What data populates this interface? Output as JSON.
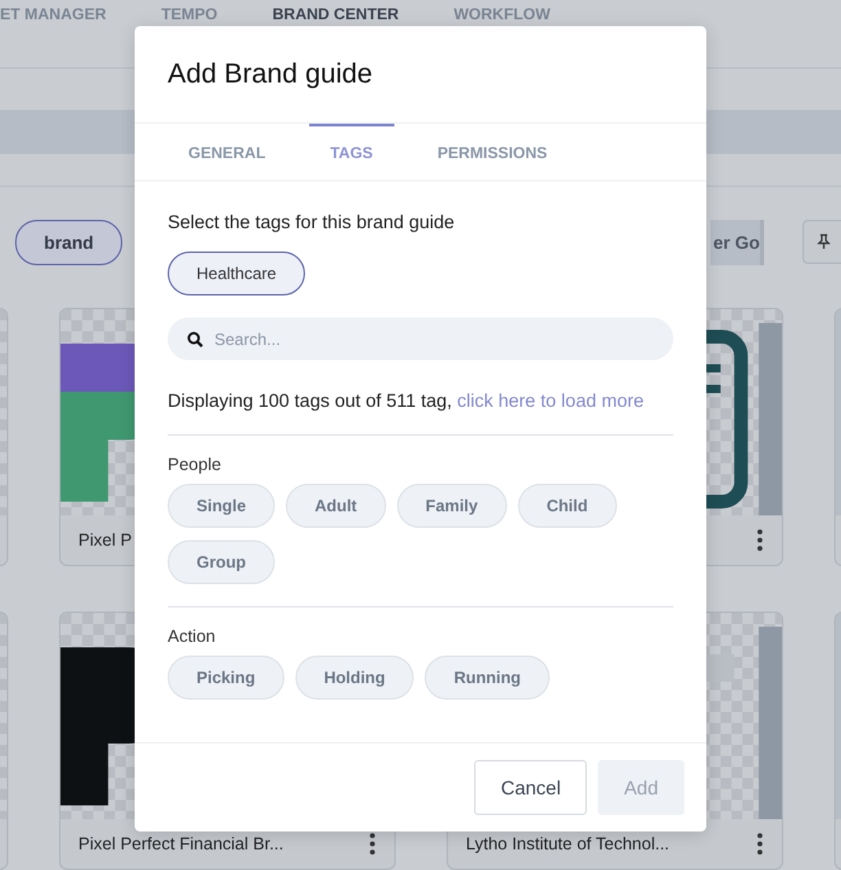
{
  "background": {
    "nav_items": [
      {
        "label": "ET MANAGER",
        "selected": false
      },
      {
        "label": "TEMPO",
        "selected": false
      },
      {
        "label": "BRAND CENTER",
        "selected": true
      },
      {
        "label": "WORKFLOW",
        "selected": false
      }
    ],
    "filter_chip": "brand",
    "partial_button": "er Go",
    "card_rows": [
      [
        {
          "kind": "picture"
        },
        {
          "kind": "picture",
          "title": "Pixel P",
          "menu": false
        },
        {
          "kind": "picture",
          "menu": true
        },
        {
          "kind": "picture"
        }
      ],
      [
        {
          "kind": "picture"
        },
        {
          "kind": "picture",
          "title": "Pixel Perfect Financial Br...",
          "menu": true
        },
        {
          "kind": "picture",
          "title": "Lytho Institute of Technol...",
          "menu": true
        },
        {
          "kind": "picture"
        }
      ]
    ]
  },
  "dialog": {
    "title": "Add Brand guide",
    "tabs": [
      {
        "label": "GENERAL",
        "selected": false
      },
      {
        "label": "TAGS",
        "selected": true
      },
      {
        "label": "PERMISSIONS",
        "selected": false
      }
    ],
    "prompt": "Select the tags for this brand guide",
    "selected_tags": [
      "Healthcare"
    ],
    "search": {
      "placeholder": "Search..."
    },
    "info": "Displaying 100 tags out of 511 tag,",
    "info_link": "click here to load more",
    "groups": [
      {
        "name": "People",
        "tags": [
          "Single",
          "Adult",
          "Family",
          "Child",
          "Group"
        ]
      },
      {
        "name": "Action",
        "tags": [
          "Picking",
          "Holding",
          "Running"
        ]
      }
    ],
    "buttons": [
      {
        "label": "Cancel",
        "disabled": false
      },
      {
        "label": "Add",
        "disabled": true
      }
    ]
  }
}
